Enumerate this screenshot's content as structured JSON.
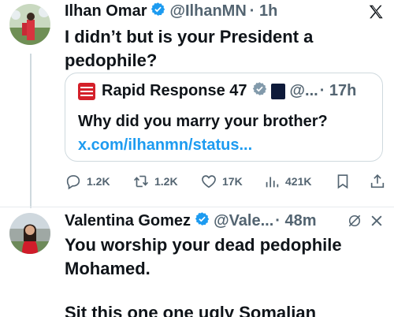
{
  "tweet1": {
    "name": "Ilhan Omar",
    "handle": "@IlhanMN",
    "time": "· 1h",
    "text_line1": "I didn’t but is your President a",
    "text_line2": "pedophile?"
  },
  "quote": {
    "name": "Rapid Response 47",
    "handle": "@...",
    "time": "· 17h",
    "text": "Why did you marry your brother?",
    "link": "x.com/ilhanmn/status..."
  },
  "actions": {
    "replies": "1.2K",
    "reposts": "1.2K",
    "likes": "17K",
    "views": "421K"
  },
  "tweet2": {
    "name": "Valentina Gomez",
    "handle": "@Vale...",
    "time": "· 48m",
    "text_line1": "You worship your dead pedophile",
    "text_line2": "Mohamed.",
    "text_line3": "Sit this one one ugly Somalian"
  },
  "colors": {
    "verified": "#1d9bf0",
    "link": "#1d9bf0",
    "muted": "#536471",
    "text": "#0f1419"
  },
  "icons": [
    "x-logo-icon",
    "verified-icon",
    "reply-icon",
    "repost-icon",
    "like-icon",
    "views-icon",
    "bookmark-icon",
    "share-icon",
    "grok-icon",
    "close-icon"
  ]
}
